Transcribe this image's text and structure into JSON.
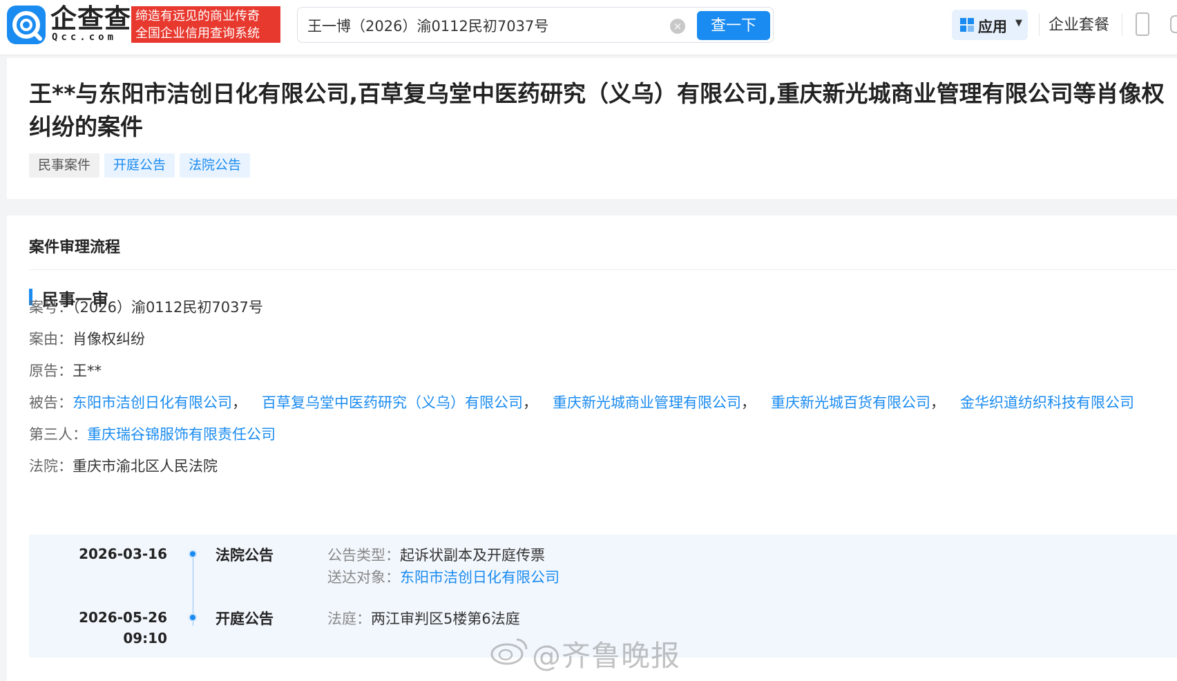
{
  "header": {
    "logo_text": "企查查",
    "logo_sub": "Qcc.com",
    "slogan_line1": "缔造有远见的商业传奇",
    "slogan_line2": "全国企业信用查询系统",
    "search_value": "王一博（2026）渝0112民初7037号",
    "search_button": "查一下",
    "apps_label": "应用",
    "package_link": "企业套餐"
  },
  "title_card": {
    "title": "王**与东阳市洁创日化有限公司,百草复乌堂中医药研究（义乌）有限公司,重庆新光城商业管理有限公司等肖像权纠纷的案件",
    "tags": [
      "民事案件",
      "开庭公告",
      "法院公告"
    ]
  },
  "process": {
    "section_title": "案件审理流程",
    "stage_title": "民事一审",
    "case_no_label": "案号：",
    "case_no": "（2026）渝0112民初7037号",
    "cause_label": "案由：",
    "cause": "肖像权纠纷",
    "plaintiff_label": "原告：",
    "plaintiff": "王**",
    "defendant_label": "被告：",
    "defendants": [
      "东阳市洁创日化有限公司",
      "百草复乌堂中医药研究（义乌）有限公司",
      "重庆新光城商业管理有限公司",
      "重庆新光城百货有限公司",
      "金华织道纺织科技有限公司"
    ],
    "separator": "，",
    "third_party_label": "第三人：",
    "third_party": "重庆瑞谷锦服饰有限责任公司",
    "court_label": "法院：",
    "court": "重庆市渝北区人民法院"
  },
  "timeline": {
    "events": [
      {
        "date": "2026-03-16",
        "type": "法院公告",
        "notice_type_label": "公告类型：",
        "notice_type": "起诉状副本及开庭传票",
        "recipient_label": "送达对象：",
        "recipient": "东阳市洁创日化有限公司"
      },
      {
        "date": "2026-05-26",
        "time": "09:10",
        "type": "开庭公告",
        "courtroom_label": "法庭：",
        "courtroom": "两江审判区5楼第6法庭"
      }
    ]
  },
  "watermark": "@齐鲁晚报",
  "colors": {
    "accent": "#1a8bf0",
    "slogan_bg": "#e8392f"
  },
  "icons": [
    "qcc-logo-icon",
    "clear-icon",
    "apps-grid-icon",
    "caret-down-icon",
    "phone-icon",
    "bell-icon",
    "weibo-icon"
  ]
}
